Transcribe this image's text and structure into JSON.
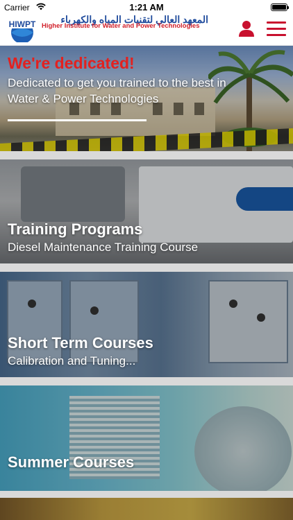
{
  "status_bar": {
    "carrier": "Carrier",
    "time": "1:21 AM"
  },
  "header": {
    "logo_abbr": "HIWPT",
    "logo_text_ar": "المعهد العالي لتقنيات المياه والكهرباء",
    "logo_text_en": "Higher Institute for Water and Power Technologies"
  },
  "hero": {
    "title": "We're dedicated!",
    "subtitle": "Dedicated to get you trained to the best in Water & Power Technologies"
  },
  "cards": [
    {
      "title": "Training Programs",
      "subtitle": "Diesel Maintenance Training Course"
    },
    {
      "title": "Short Term Courses",
      "subtitle": "Calibration and Tuning..."
    },
    {
      "title": "Summer Courses",
      "subtitle": ""
    }
  ],
  "colors": {
    "accent_red": "#c8102e",
    "brand_blue": "#1e4a9c",
    "hero_title_red": "#e3211f"
  },
  "icons": {
    "user": "user-icon",
    "menu": "hamburger-menu-icon",
    "wifi": "wifi-icon",
    "battery": "battery-icon"
  }
}
